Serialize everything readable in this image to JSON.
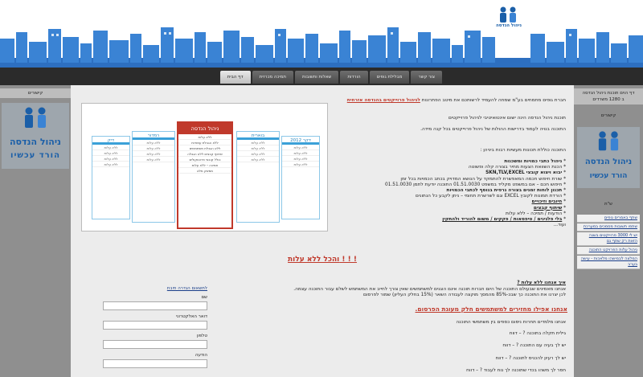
{
  "logo": {
    "text": "ניהול הנדסה",
    "icon": "people-logo-icon"
  },
  "nav": {
    "items": [
      {
        "label": "דף הבית",
        "active": true
      },
      {
        "label": "תמיכה מכרזית",
        "active": false
      },
      {
        "label": "שאלות ותשובות",
        "active": false
      },
      {
        "label": "הורדות",
        "active": false
      },
      {
        "label": "מבלילת גופים",
        "active": false
      },
      {
        "label": "צור קשר",
        "active": false
      }
    ]
  },
  "left_col": {
    "title": "קישורים",
    "logo_line1": "ניהול הנדסה",
    "logo_line2": "הורד עכשיו"
  },
  "right_col": {
    "title_line1": "דף הוים תוכנת ניהול הנדסה",
    "title_line2": "ב 1280 משרדים",
    "links_title": "קישורים",
    "logo_line1": "ניהול הנדסה",
    "logo_line2": "הורד עכשיו",
    "section_title": "ש\"ת",
    "links": [
      "שתף באמרים גופים",
      "שתפו תשובות מסמכים במערכת",
      "יש לי 3000 פרוייקטים בשנה הזאת רק שתף גם",
      "ניהול עלות הפרויקט התוכנה",
      "המלצה לבמישהו מלאכות - עישה בערב"
    ]
  },
  "main": {
    "intro_1": "חברת גופים מתמחים בע\"מ שמחה להעמיד לרשותכם את מיטב הפתרונות",
    "intro_1_bold": "לניהול פרוייקטים בהנדסה אזרחית",
    "intro_2": "תוכנת ניהול הנדסה הינה ישום אינטואיטיבי לניהול פרוייקטים",
    "intro_3": "התוכנה בנויה לעמוד בדרישות ההולות של ניהול פרוייקטים בכל קנה מידה.",
    "features_title": "התוכנה כוללת תכונות מעשיות רבות ביניהן :",
    "features": [
      "ניהול כתבי כמויות ומשכנות",
      "הכנת השוואת הצעות מחיר בצורה קלה ופשוטה",
      "יבוא ויצוא קובצי SKN,TLV,EXCEL",
      "שורת חיפוש חכמה המאפשרת להתמקד על הנושא המדויק בכתב הכמויות בכל זמן",
      "חיפוש חכם – אם במשפט מקליד במשפט 01.51.0030 התוכנה יודעת לתמן 01.51.0030",
      "תכנון לוחות זמנים בצורה גרפית בנוסף לכתבי הכמויות",
      "הורדת תמונות לקובץ EXCEL וגם לשרשרת תחומי – ניתן לקבע כל הנתונים",
      "חיובים וזיכויים",
      "שיתוף קבצים",
      "הודעות / תמיכה – ללא עלות",
      "בלי פלגינים / טיפסאות / פקקים / משום להוריד ולהתקין"
    ],
    "etc": "ועוד...",
    "promo": {
      "featured_title": "ניהול הנדסה",
      "featured_rows": [
        "ללא עלות",
        "ללא הגבלת עמודות",
        "ללא הגבלת משתמשים",
        "שיתוף קבצים ללא הגבלה",
        "כולל קובצי פרוטוקולים",
        "תמיכה – ללא עלות",
        "ממשק מלא"
      ],
      "card_titles": [
        "דקר 2012",
        "בוארית",
        "רמדור",
        "דיק"
      ],
      "card_row_text": "ללא עלות"
    },
    "headline": "והכל ללא עלות ! ! !",
    "how_title": "איך אנחנו ללא עלות ?",
    "how_text_1": "אנחנו מאמינים שבעולם התוכנה של היום חברות תוכנה אינם הוגנים למשתמשים שאין צורך לחייב את המשתמש לשלם עבור התוכנה עצמה.",
    "how_text_2": "לכן יצרנו את התוכנה כך שבכ-85% מהמסך מוקצה לעבודה השאר (15% בחלק העליון) שמור לפרסום",
    "sale": "אנחנו אפילו מחזירים למשתמשים חלק מעוגת הפרסום.",
    "sale_sub": "אנחנו מלמדים תחרות ניסום כספים בין משתמשי התוכנה",
    "questions": [
      "גילית תקלה בתוכנה ? – דווח",
      "יש לך בעיה עם התוכנה ? – דווח",
      "יש לך רעיון להכניס לתוכנה ? – דווח",
      "חסר לך משהו בכדי שתוכנה לך נוח לעבוד ? – דווח"
    ]
  },
  "form": {
    "title_link": "לתשאום הגדרה תיבת",
    "name_label": "שם",
    "email_label": "דואר האלקטרוני",
    "phone_label": "טלפון",
    "message_label": "הודעה"
  }
}
